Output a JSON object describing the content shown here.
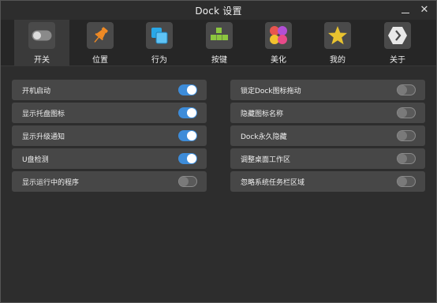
{
  "window": {
    "title": "Dock 设置"
  },
  "tabs": [
    {
      "label": "开关",
      "icon": "toggle-icon"
    },
    {
      "label": "位置",
      "icon": "pin-icon"
    },
    {
      "label": "行为",
      "icon": "layers-icon"
    },
    {
      "label": "按键",
      "icon": "keys-icon"
    },
    {
      "label": "美化",
      "icon": "palette-icon"
    },
    {
      "label": "我的",
      "icon": "star-icon"
    },
    {
      "label": "关于",
      "icon": "hexagon-icon"
    }
  ],
  "left_options": [
    {
      "label": "开机启动",
      "enabled": true
    },
    {
      "label": "显示托盘图标",
      "enabled": true
    },
    {
      "label": "显示升级通知",
      "enabled": true
    },
    {
      "label": "U盘检测",
      "enabled": true
    },
    {
      "label": "显示运行中的程序",
      "enabled": false
    }
  ],
  "right_options": [
    {
      "label": "锁定Dock图标拖动",
      "enabled": false
    },
    {
      "label": "隐藏图标名称",
      "enabled": false
    },
    {
      "label": "Dock永久隐藏",
      "enabled": false
    },
    {
      "label": "调整桌面工作区",
      "enabled": false
    },
    {
      "label": "忽略系统任务栏区域",
      "enabled": false
    }
  ],
  "colors": {
    "accent": "#3d8cd9",
    "row_bg": "#474747",
    "window_bg": "#2d2d2d"
  }
}
